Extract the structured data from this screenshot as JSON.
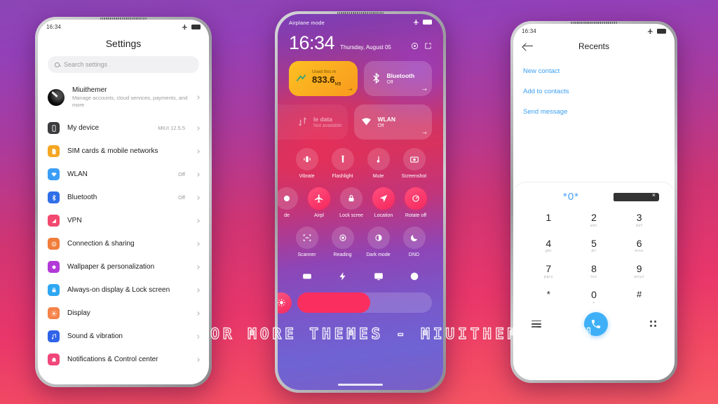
{
  "watermark": "VISIT FOR MORE THEMES - MIUITHEMER.COM",
  "colors": {
    "background_top": "#8b45b5",
    "background_bottom": "#f65a63",
    "accent_pink": "#f5285e",
    "accent_blue": "#3fb0f7",
    "link_blue": "#3a9ff0",
    "amber_tile": "#fcc022"
  },
  "phone_left": {
    "status": {
      "time": "16:34",
      "airplane_icon": "airplane-icon",
      "battery_icon": "battery-icon"
    },
    "title": "Settings",
    "search": {
      "placeholder": "Search settings",
      "icon": "search-icon"
    },
    "account": {
      "name": "Miuithemer",
      "subtitle": "Manage accounts, cloud services, payments, and more"
    },
    "items": [
      {
        "label": "My device",
        "value": "MIUI 12.5.5",
        "icon": "phone-icon",
        "color": "#3c3c3e"
      },
      {
        "label": "SIM cards & mobile networks",
        "value": "",
        "icon": "sim-icon",
        "color": "#f5a623"
      },
      {
        "label": "WLAN",
        "value": "Off",
        "icon": "wifi-icon",
        "color": "#3b9df5"
      },
      {
        "label": "Bluetooth",
        "value": "Off",
        "icon": "bluetooth-icon",
        "color": "#2f6fe8"
      },
      {
        "label": "VPN",
        "value": "",
        "icon": "vpn-icon",
        "color": "#f3486f"
      },
      {
        "label": "Connection & sharing",
        "value": "",
        "icon": "share-icon",
        "color": "#f07d3a"
      },
      {
        "label": "Wallpaper & personalization",
        "value": "",
        "icon": "wallpaper-icon",
        "color": "#b23ad8"
      },
      {
        "label": "Always-on display & Lock screen",
        "value": "",
        "icon": "lock-display-icon",
        "color": "#2fa7f2"
      },
      {
        "label": "Display",
        "value": "",
        "icon": "brightness-icon",
        "color": "#f5834a"
      },
      {
        "label": "Sound & vibration",
        "value": "",
        "icon": "sound-icon",
        "color": "#2f63e8"
      },
      {
        "label": "Notifications & Control center",
        "value": "",
        "icon": "bell-icon",
        "color": "#f0467a"
      }
    ]
  },
  "phone_middle": {
    "status": {
      "airplane_label": "Airplane mode",
      "airplane_icon": "airplane-icon",
      "battery_icon": "battery-icon"
    },
    "clock": "16:34",
    "date": "Thursday, August 05",
    "header_icons": [
      "settings-gear-icon",
      "edit-icon"
    ],
    "tiles": [
      {
        "caption": "Used this m",
        "value": "833.6",
        "unit": "MB",
        "icon": "data-usage-icon",
        "style": "amber"
      },
      {
        "label": "Bluetooth",
        "sub": "Off",
        "icon": "bluetooth-icon",
        "style": "glass"
      },
      {
        "label": "le data",
        "sub": "Not available",
        "icon": "mobile-data-icon",
        "style": "dim"
      },
      {
        "label": "WLAN",
        "sub": "Off",
        "icon": "wifi-icon",
        "style": "glass"
      }
    ],
    "toggles_row1": [
      {
        "label": "Vibrate",
        "icon": "vibrate-icon",
        "on": false
      },
      {
        "label": "Flashlight",
        "icon": "flashlight-icon",
        "on": false
      },
      {
        "label": "Mute",
        "icon": "mute-icon",
        "on": false
      },
      {
        "label": "Screenshot",
        "icon": "screenshot-icon",
        "on": false
      }
    ],
    "toggles_row2": [
      {
        "label": "de",
        "icon": "dark-icon",
        "on": false
      },
      {
        "label": "Airpl",
        "icon": "airplane-icon",
        "on": true
      },
      {
        "label": "Lock scree",
        "icon": "lock-icon",
        "on": false
      },
      {
        "label": "Location",
        "icon": "location-icon",
        "on": true
      },
      {
        "label": "Rotate off",
        "icon": "rotate-icon",
        "on": true
      }
    ],
    "toggles_row3": [
      {
        "label": "Scanner",
        "icon": "scanner-icon",
        "on": false
      },
      {
        "label": "Reading",
        "icon": "reading-icon",
        "on": false
      },
      {
        "label": "Dark mode",
        "icon": "dark-mode-icon",
        "on": false
      },
      {
        "label": "DND",
        "icon": "moon-icon",
        "on": false
      }
    ],
    "shortcuts": [
      "screen-record-icon",
      "lightning-icon",
      "cast-icon",
      "contrast-icon"
    ],
    "brightness": {
      "icon": "brightness-icon",
      "percent": 54
    }
  },
  "phone_right": {
    "status": {
      "time": "16:34",
      "airplane_icon": "airplane-icon",
      "battery_icon": "battery-icon"
    },
    "back_icon": "back-arrow-icon",
    "title": "Recents",
    "links": [
      "New contact",
      "Add to contacts",
      "Send message"
    ],
    "dialer": {
      "number": "*0*",
      "delete_icon": "backspace-icon",
      "keys": [
        {
          "digit": "1",
          "letters": ""
        },
        {
          "digit": "2",
          "letters": "abc"
        },
        {
          "digit": "3",
          "letters": "def"
        },
        {
          "digit": "4",
          "letters": "ghi"
        },
        {
          "digit": "5",
          "letters": "jkl"
        },
        {
          "digit": "6",
          "letters": "mno"
        },
        {
          "digit": "7",
          "letters": "pqrs"
        },
        {
          "digit": "8",
          "letters": "tuv"
        },
        {
          "digit": "9",
          "letters": "wxyz"
        },
        {
          "digit": "*",
          "letters": ""
        },
        {
          "digit": "0",
          "letters": "+"
        },
        {
          "digit": "#",
          "letters": ""
        }
      ],
      "left_icon": "list-icon",
      "call_icon": "call-icon",
      "right_icon": "keypad-grid-icon"
    }
  }
}
